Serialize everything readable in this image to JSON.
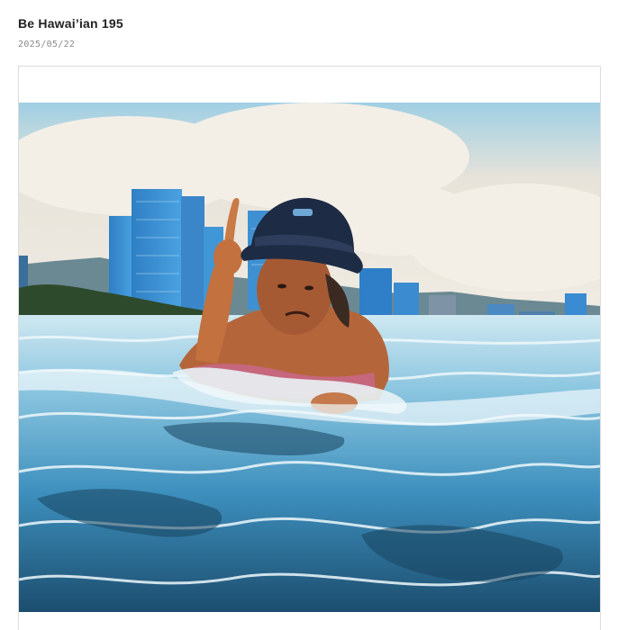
{
  "post": {
    "title": "Be Hawai’ian 195",
    "date": "2025/05/22"
  },
  "photo": {
    "subject": "person-in-ocean-icon",
    "colors": {
      "sky": "#e9e2d6",
      "sky_blue": "#8fc7dd",
      "building_blue": "#3f8fd0",
      "hills": "#5f7f8a",
      "trees": "#2f4a2a",
      "water_light": "#d9eef4",
      "water_mid": "#5fb2d8",
      "water_dark": "#1b4f73",
      "skin": "#b5653a",
      "hat": "#1e2b44"
    }
  }
}
